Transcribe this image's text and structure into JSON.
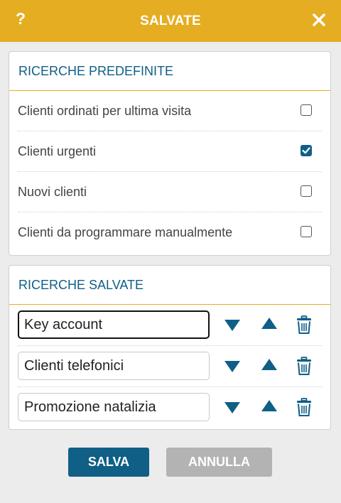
{
  "header": {
    "title": "SALVATE",
    "help_label": "?"
  },
  "predefined": {
    "title": "RICERCHE PREDEFINITE",
    "items": [
      {
        "label": "Clienti ordinati per ultima visita",
        "checked": false
      },
      {
        "label": "Clienti urgenti",
        "checked": true
      },
      {
        "label": "Nuovi clienti",
        "checked": false
      },
      {
        "label": "Clienti da programmare manualmente",
        "checked": false
      }
    ]
  },
  "saved": {
    "title": "RICERCHE SALVATE",
    "items": [
      {
        "value": "Key account"
      },
      {
        "value": "Clienti telefonici"
      },
      {
        "value": "Promozione natalizia"
      }
    ]
  },
  "footer": {
    "save_label": "SALVA",
    "cancel_label": "ANNULLA"
  },
  "icons": {
    "close": "close-icon",
    "help": "help-icon",
    "down": "arrow-down-icon",
    "up": "arrow-up-icon",
    "trash": "trash-icon",
    "check": "check-icon"
  },
  "colors": {
    "accent": "#e5ad21",
    "primary": "#0f5f86",
    "disabled": "#b3b3b3"
  }
}
